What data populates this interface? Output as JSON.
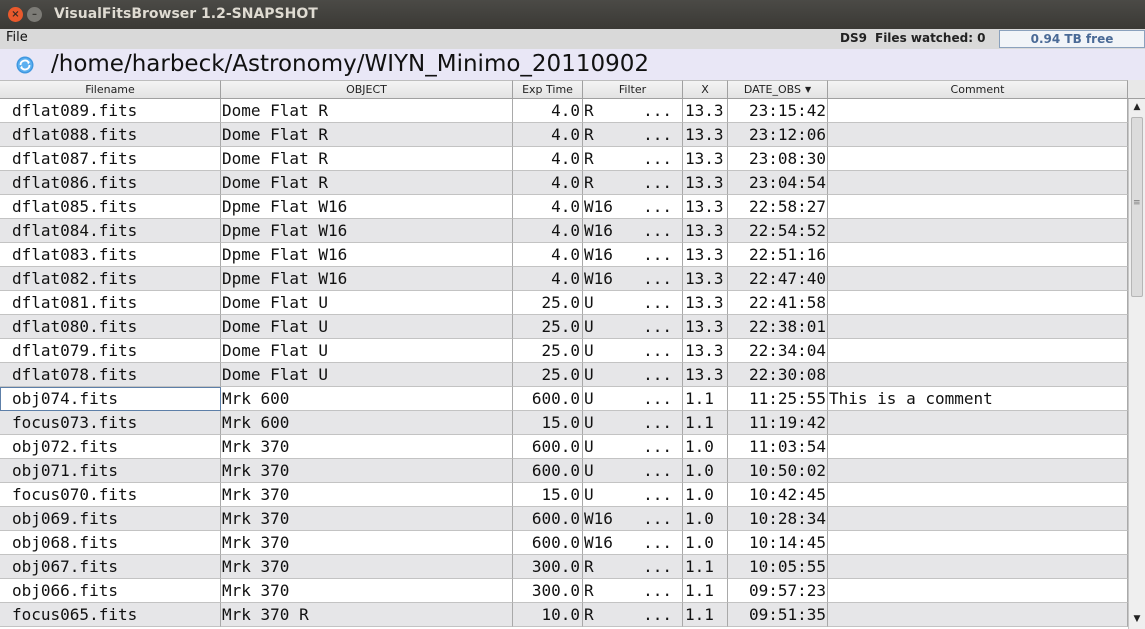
{
  "window": {
    "title": "VisualFitsBrowser 1.2-SNAPSHOT",
    "close_glyph": "×",
    "minimize_glyph": "–"
  },
  "menubar": {
    "file_label": "File",
    "ds9_label": "DS9",
    "files_watched_label": "Files watched: 0",
    "disk_free": "0.94 TB free"
  },
  "path": {
    "icon": "refresh-icon",
    "text": "/home/harbeck/Astronomy/WIYN_Minimo_20110902"
  },
  "table": {
    "columns": [
      "Filename",
      "OBJECT",
      "Exp Time",
      "Filter",
      "X",
      "DATE_OBS",
      "Comment"
    ],
    "sort_column": "DATE_OBS",
    "sort_glyph": "▼",
    "rows": [
      {
        "filename": "dflat089.fits",
        "object": "Dome Flat R",
        "exptime": "4.0",
        "filter": "R",
        "filter_more": "...",
        "x": "13.3",
        "date_obs": "23:15:42",
        "comment": ""
      },
      {
        "filename": "dflat088.fits",
        "object": "Dome Flat R",
        "exptime": "4.0",
        "filter": "R",
        "filter_more": "...",
        "x": "13.3",
        "date_obs": "23:12:06",
        "comment": ""
      },
      {
        "filename": "dflat087.fits",
        "object": "Dome Flat R",
        "exptime": "4.0",
        "filter": "R",
        "filter_more": "...",
        "x": "13.3",
        "date_obs": "23:08:30",
        "comment": ""
      },
      {
        "filename": "dflat086.fits",
        "object": "Dome Flat R",
        "exptime": "4.0",
        "filter": "R",
        "filter_more": "...",
        "x": "13.3",
        "date_obs": "23:04:54",
        "comment": ""
      },
      {
        "filename": "dflat085.fits",
        "object": "Dpme Flat W16",
        "exptime": "4.0",
        "filter": "W16",
        "filter_more": "...",
        "x": "13.3",
        "date_obs": "22:58:27",
        "comment": ""
      },
      {
        "filename": "dflat084.fits",
        "object": "Dpme Flat W16",
        "exptime": "4.0",
        "filter": "W16",
        "filter_more": "...",
        "x": "13.3",
        "date_obs": "22:54:52",
        "comment": ""
      },
      {
        "filename": "dflat083.fits",
        "object": "Dpme Flat W16",
        "exptime": "4.0",
        "filter": "W16",
        "filter_more": "...",
        "x": "13.3",
        "date_obs": "22:51:16",
        "comment": ""
      },
      {
        "filename": "dflat082.fits",
        "object": "Dpme Flat W16",
        "exptime": "4.0",
        "filter": "W16",
        "filter_more": "...",
        "x": "13.3",
        "date_obs": "22:47:40",
        "comment": ""
      },
      {
        "filename": "dflat081.fits",
        "object": "Dome Flat U",
        "exptime": "25.0",
        "filter": "U",
        "filter_more": "...",
        "x": "13.3",
        "date_obs": "22:41:58",
        "comment": ""
      },
      {
        "filename": "dflat080.fits",
        "object": "Dome Flat U",
        "exptime": "25.0",
        "filter": "U",
        "filter_more": "...",
        "x": "13.3",
        "date_obs": "22:38:01",
        "comment": ""
      },
      {
        "filename": "dflat079.fits",
        "object": "Dome Flat U",
        "exptime": "25.0",
        "filter": "U",
        "filter_more": "...",
        "x": "13.3",
        "date_obs": "22:34:04",
        "comment": ""
      },
      {
        "filename": "dflat078.fits",
        "object": "Dome Flat U",
        "exptime": "25.0",
        "filter": "U",
        "filter_more": "...",
        "x": "13.3",
        "date_obs": "22:30:08",
        "comment": ""
      },
      {
        "filename": "obj074.fits",
        "object": "Mrk 600",
        "exptime": "600.0",
        "filter": "U",
        "filter_more": "...",
        "x": "1.1",
        "date_obs": "11:25:55",
        "comment": "This is a comment"
      },
      {
        "filename": "focus073.fits",
        "object": "Mrk 600",
        "exptime": "15.0",
        "filter": "U",
        "filter_more": "...",
        "x": "1.1",
        "date_obs": "11:19:42",
        "comment": ""
      },
      {
        "filename": "obj072.fits",
        "object": "Mrk 370",
        "exptime": "600.0",
        "filter": "U",
        "filter_more": "...",
        "x": "1.0",
        "date_obs": "11:03:54",
        "comment": ""
      },
      {
        "filename": "obj071.fits",
        "object": "Mrk 370",
        "exptime": "600.0",
        "filter": "U",
        "filter_more": "...",
        "x": "1.0",
        "date_obs": "10:50:02",
        "comment": ""
      },
      {
        "filename": "focus070.fits",
        "object": "Mrk 370",
        "exptime": "15.0",
        "filter": "U",
        "filter_more": "...",
        "x": "1.0",
        "date_obs": "10:42:45",
        "comment": ""
      },
      {
        "filename": "obj069.fits",
        "object": "Mrk 370",
        "exptime": "600.0",
        "filter": "W16",
        "filter_more": "...",
        "x": "1.0",
        "date_obs": "10:28:34",
        "comment": ""
      },
      {
        "filename": "obj068.fits",
        "object": "Mrk 370",
        "exptime": "600.0",
        "filter": "W16",
        "filter_more": "...",
        "x": "1.0",
        "date_obs": "10:14:45",
        "comment": ""
      },
      {
        "filename": "obj067.fits",
        "object": "Mrk 370",
        "exptime": "300.0",
        "filter": "R",
        "filter_more": "...",
        "x": "1.1",
        "date_obs": "10:05:55",
        "comment": ""
      },
      {
        "filename": "obj066.fits",
        "object": "Mrk 370",
        "exptime": "300.0",
        "filter": "R",
        "filter_more": "...",
        "x": "1.1",
        "date_obs": "09:57:23",
        "comment": ""
      },
      {
        "filename": "focus065.fits",
        "object": "Mrk 370 R",
        "exptime": "10.0",
        "filter": "R",
        "filter_more": "...",
        "x": "1.1",
        "date_obs": "09:51:35",
        "comment": ""
      }
    ],
    "focused_row": 12
  },
  "scrollbar": {
    "up_glyph": "▲",
    "down_glyph": "▼",
    "grip_glyph": "≡"
  }
}
